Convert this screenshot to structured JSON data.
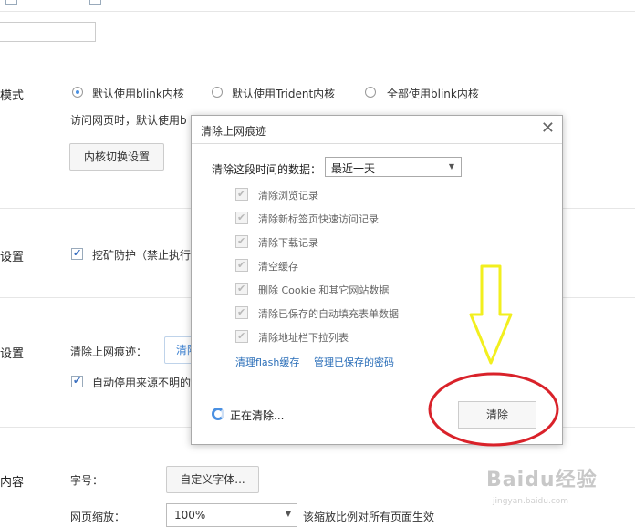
{
  "top": {
    "checkbox_labels": [
      "",
      ""
    ]
  },
  "kernel": {
    "section_label": "模式",
    "options": [
      "默认使用blink内核",
      "默认使用Trident内核",
      "全部使用blink内核"
    ],
    "selected": 0,
    "desc": "访问网页时，默认使用b",
    "switch_button": "内核切换设置"
  },
  "settings1": {
    "section_label": "设置",
    "mining_label": "挖矿防护（禁止执行"
  },
  "settings2": {
    "section_label": "设置",
    "trace_label": "清除上网痕迹：",
    "trace_button": "清除",
    "autodisable_label": "自动停用来源不明的"
  },
  "content": {
    "section_label": "内容",
    "font_label": "字号：",
    "font_button": "自定义字体...",
    "zoom_label": "网页缩放：",
    "zoom_value": "100%",
    "zoom_desc": "该缩放比例对所有页面生效"
  },
  "dialog": {
    "title": "清除上网痕迹",
    "close": "✕",
    "period_label": "清除这段时间的数据：",
    "period_value": "最近一天",
    "items": [
      "清除浏览记录",
      "清除新标签页快速访问记录",
      "清除下载记录",
      "清空缓存",
      "删除 Cookie 和其它网站数据",
      "清除已保存的自动填充表单数据",
      "清除地址栏下拉列表"
    ],
    "link_flash": "清理flash缓存",
    "link_passwords": "管理已保存的密码",
    "status": "正在清除...",
    "clear_button": "清除"
  },
  "watermark": {
    "text": "Baidu经验",
    "sub": "jingyan.baidu.com"
  },
  "colors": {
    "accent": "#4a90e2",
    "annotation_red": "#d9222a",
    "annotation_yellow": "#f2ef1e"
  }
}
